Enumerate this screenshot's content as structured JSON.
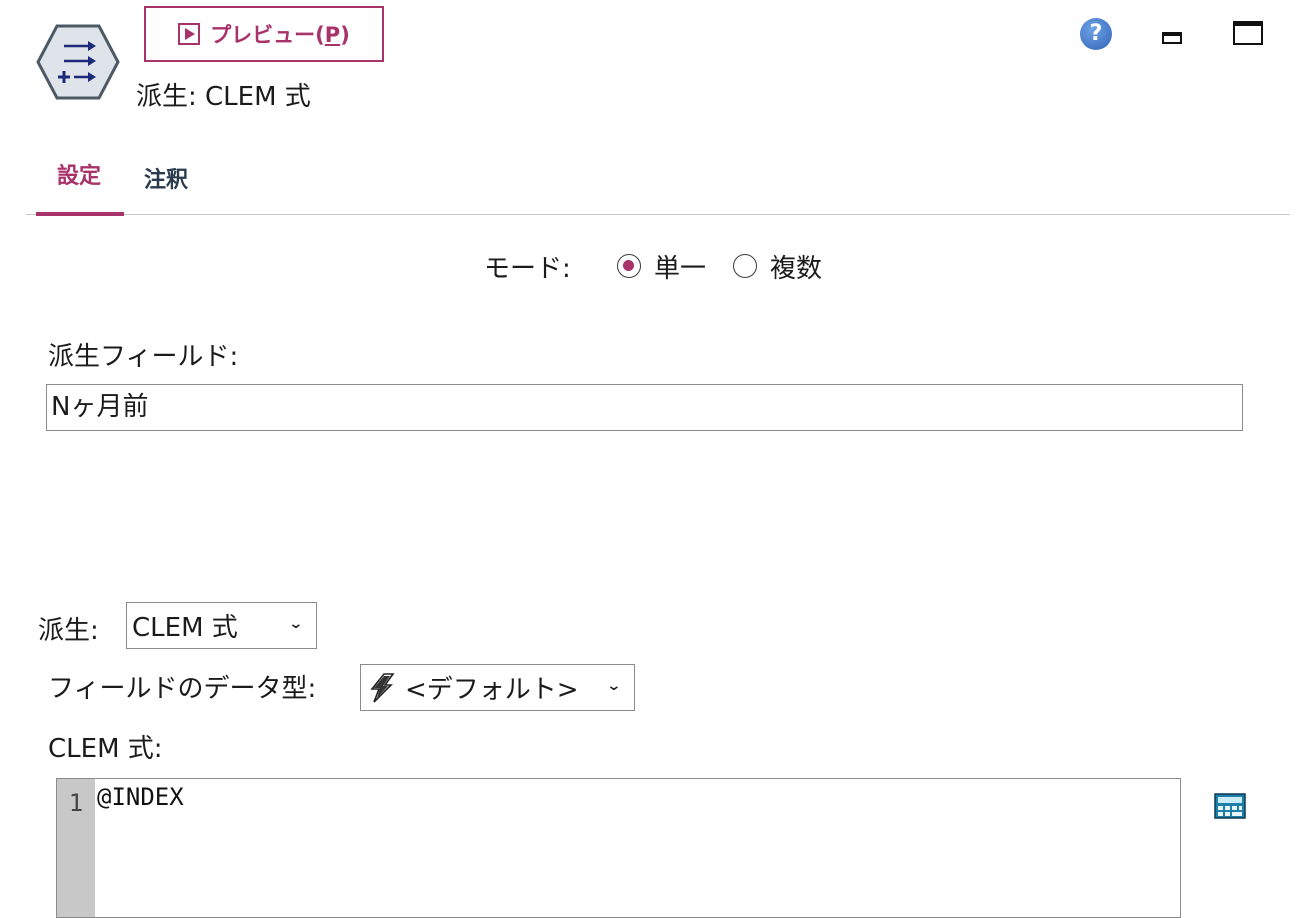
{
  "header": {
    "preview_label": "プレビュー(",
    "preview_mnemonic": "P",
    "preview_close": ")",
    "node_title": "派生: CLEM 式",
    "help_glyph": "?"
  },
  "tabs": [
    {
      "label": "設定",
      "active": true
    },
    {
      "label": "注釈",
      "active": false
    }
  ],
  "mode": {
    "label": "モード:",
    "options": [
      {
        "label": "単一",
        "selected": true
      },
      {
        "label": "複数",
        "selected": false
      }
    ]
  },
  "derive_field": {
    "label": "派生フィールド:",
    "value": "Nヶ月前"
  },
  "derive_as": {
    "label": "派生:",
    "selected": "CLEM 式"
  },
  "field_type": {
    "label": "フィールドのデータ型:",
    "selected": "<デフォルト>"
  },
  "clem": {
    "label": "CLEM 式:",
    "lines": [
      {
        "number": "1",
        "code": "@INDEX"
      }
    ]
  },
  "colors": {
    "accent": "#a8326a",
    "tab_inactive": "#2a3b4d",
    "help_blue": "#2f64b8",
    "gutter": "#c8c8c8"
  },
  "icons": {
    "node": "derive-node-icon",
    "preview": "play-icon",
    "help": "help-icon",
    "minimize": "minimize-icon",
    "maximize": "maximize-icon",
    "field_type": "lightning-bolt-icon",
    "expression_builder": "calculator-icon"
  }
}
